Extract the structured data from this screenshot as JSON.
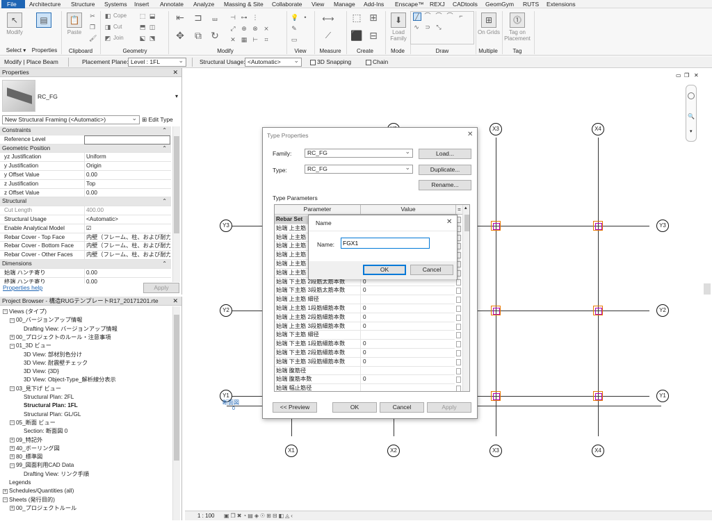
{
  "menu": {
    "file": "File",
    "items": [
      "Architecture",
      "Structure",
      "Systems",
      "Insert",
      "Annotate",
      "Analyze",
      "Massing & Site",
      "Collaborate",
      "View",
      "Manage",
      "Add-Ins",
      "Enscape™",
      "REXJ",
      "CADtools",
      "GeomGym",
      "RUTS",
      "Extensions"
    ]
  },
  "ribbon": {
    "modify": "Modify",
    "select": "Select ▾",
    "properties": "Properties",
    "paste": "Paste",
    "clipboard": "Clipboard",
    "cope": "Cope",
    "cut": "Cut",
    "join": "Join",
    "geometry": "Geometry",
    "modify_panel": "Modify",
    "view": "View",
    "measure": "Measure",
    "create": "Create",
    "load_family": "Load Family",
    "mode": "Mode",
    "draw": "Draw",
    "on_grids": "On Grids",
    "multiple": "Multiple",
    "tag_on_placement": "Tag on Placement",
    "tag": "Tag"
  },
  "optbar": {
    "context": "Modify | Place Beam",
    "placement_plane_label": "Placement Plane:",
    "placement_plane": "Level : 1FL",
    "structural_usage_label": "Structural Usage:",
    "structural_usage": "<Automatic>",
    "snapping": "3D Snapping",
    "chain": "Chain"
  },
  "properties": {
    "title": "Properties",
    "type_name": "RC_FG",
    "instance_dropdown": "New Structural Framing (<Automatic>)",
    "edit_type": "Edit Type",
    "rows": [
      {
        "k": "Constraints",
        "sec": true
      },
      {
        "k": "Reference Level",
        "v": ""
      },
      {
        "k": "Geometric Position",
        "sec": true
      },
      {
        "k": "yz Justification",
        "v": "Uniform"
      },
      {
        "k": "y Justification",
        "v": "Origin"
      },
      {
        "k": "y Offset Value",
        "v": "0.00"
      },
      {
        "k": "z Justification",
        "v": "Top"
      },
      {
        "k": "z Offset Value",
        "v": "0.00"
      },
      {
        "k": "Structural",
        "sec": true
      },
      {
        "k": "Cut Length",
        "v": "400.00",
        "dis": true
      },
      {
        "k": "Structural Usage",
        "v": "<Automatic>"
      },
      {
        "k": "Enable Analytical Model",
        "v": "☑"
      },
      {
        "k": "Rebar Cover - Top Face",
        "v": "内壁（フレーム、柱、および耐力..."
      },
      {
        "k": "Rebar Cover - Bottom Face",
        "v": "内壁（フレーム、柱、および耐力..."
      },
      {
        "k": "Rebar Cover - Other Faces",
        "v": "内壁（フレーム、柱、および耐力..."
      },
      {
        "k": "Dimensions",
        "sec": true
      },
      {
        "k": "始端 ハンチ寄り",
        "v": "0.00"
      },
      {
        "k": "終端 ハンチ寄り",
        "v": "0.00"
      }
    ],
    "help": "Properties help",
    "apply": "Apply"
  },
  "browser": {
    "title": "Project Browser - 構造RUGテンプレートR17_20171201.rte",
    "items": [
      {
        "t": "Views (タイプ)",
        "lv": 0,
        "tg": "−"
      },
      {
        "t": "00_バージョンアップ情報",
        "lv": 1,
        "tg": "−"
      },
      {
        "t": "Drafting View: バージョンアップ情報",
        "lv": 3
      },
      {
        "t": "00_プロジェクトのルール・注意事項",
        "lv": 1,
        "tg": "+"
      },
      {
        "t": "01_3D ビュー",
        "lv": 1,
        "tg": "−"
      },
      {
        "t": "3D View: 部材別色分け",
        "lv": 3
      },
      {
        "t": "3D View: 耐震壁チェック",
        "lv": 3
      },
      {
        "t": "3D View: {3D}",
        "lv": 3
      },
      {
        "t": "3D View: Object-Type_解析線分表示",
        "lv": 3
      },
      {
        "t": "03_見下げ ビュー",
        "lv": 1,
        "tg": "−"
      },
      {
        "t": "Structural Plan: 2FL",
        "lv": 3
      },
      {
        "t": "Structural Plan: 1FL",
        "lv": 3,
        "bold": true
      },
      {
        "t": "Structural Plan: GL/GL",
        "lv": 3
      },
      {
        "t": "05_断面 ビュー",
        "lv": 1,
        "tg": "−"
      },
      {
        "t": "Section: 断面図 0",
        "lv": 3
      },
      {
        "t": "09_特記外",
        "lv": 1,
        "tg": "+"
      },
      {
        "t": "40_ボーリング図",
        "lv": 1,
        "tg": "+"
      },
      {
        "t": "80_標準図",
        "lv": 1,
        "tg": "+"
      },
      {
        "t": "99_図面利用CAD Data",
        "lv": 1,
        "tg": "−"
      },
      {
        "t": "Drafting View: リンク手順",
        "lv": 3
      },
      {
        "t": "Legends",
        "lv": 0,
        "tg": ""
      },
      {
        "t": "Schedules/Quantities (all)",
        "lv": 0,
        "tg": "+"
      },
      {
        "t": "Sheets (発行目的)",
        "lv": 0,
        "tg": "−"
      },
      {
        "t": "00_プロジェクトルール",
        "lv": 1,
        "tg": "+"
      }
    ]
  },
  "grids": {
    "top": [
      "X1",
      "X2",
      "X3",
      "X4"
    ],
    "bottom": [
      "X1",
      "X2",
      "X3",
      "X4"
    ],
    "left": [
      "Y3",
      "Y2",
      "Y1"
    ],
    "right": [
      "Y3",
      "Y2",
      "Y1"
    ],
    "marker": "断面図",
    "marker_num": "0"
  },
  "status": {
    "scale": "1 : 100"
  },
  "type_dialog": {
    "title": "Type Properties",
    "family_label": "Family:",
    "family": "RC_FG",
    "type_label": "Type:",
    "type": "RC_FG",
    "load": "Load...",
    "duplicate": "Duplicate...",
    "rename": "Rename...",
    "type_params": "Type Parameters",
    "col_param": "Parameter",
    "col_value": "Value",
    "eq": "=",
    "rows": [
      {
        "k": "Rebar Set",
        "v": "",
        "sec": true
      },
      {
        "k": "始端 上主筋 ...",
        "v": ""
      },
      {
        "k": "始端 上主筋 ...",
        "v": ""
      },
      {
        "k": "始端 上主筋 2...",
        "v": ""
      },
      {
        "k": "始端 上主筋 ...",
        "v": ""
      },
      {
        "k": "始端 上主筋 ...",
        "v": ""
      },
      {
        "k": "始端 上主筋 ...",
        "v": ""
      },
      {
        "k": "始端 下主筋 2段筋太筋本数",
        "v": "0"
      },
      {
        "k": "始端 下主筋 3段筋太筋本数",
        "v": "0"
      },
      {
        "k": "始端 上主筋 細径",
        "v": ""
      },
      {
        "k": "始端 上主筋 1段筋細筋本数",
        "v": "0"
      },
      {
        "k": "始端 上主筋 2段筋細筋本数",
        "v": "0"
      },
      {
        "k": "始端 上主筋 3段筋細筋本数",
        "v": "0"
      },
      {
        "k": "始端 下主筋 細径",
        "v": ""
      },
      {
        "k": "始端 下主筋 1段筋細筋本数",
        "v": "0"
      },
      {
        "k": "始端 下主筋 2段筋細筋本数",
        "v": "0"
      },
      {
        "k": "始端 下主筋 3段筋細筋本数",
        "v": "0"
      },
      {
        "k": "始端 腹筋径",
        "v": ""
      },
      {
        "k": "始端 腹筋本数",
        "v": "0"
      },
      {
        "k": "始端 幅止筋径",
        "v": ""
      }
    ],
    "preview": "<< Preview",
    "ok": "OK",
    "cancel": "Cancel",
    "apply": "Apply"
  },
  "name_dialog": {
    "title": "Name",
    "label": "Name:",
    "value": "FGX1",
    "ok": "OK",
    "cancel": "Cancel"
  }
}
